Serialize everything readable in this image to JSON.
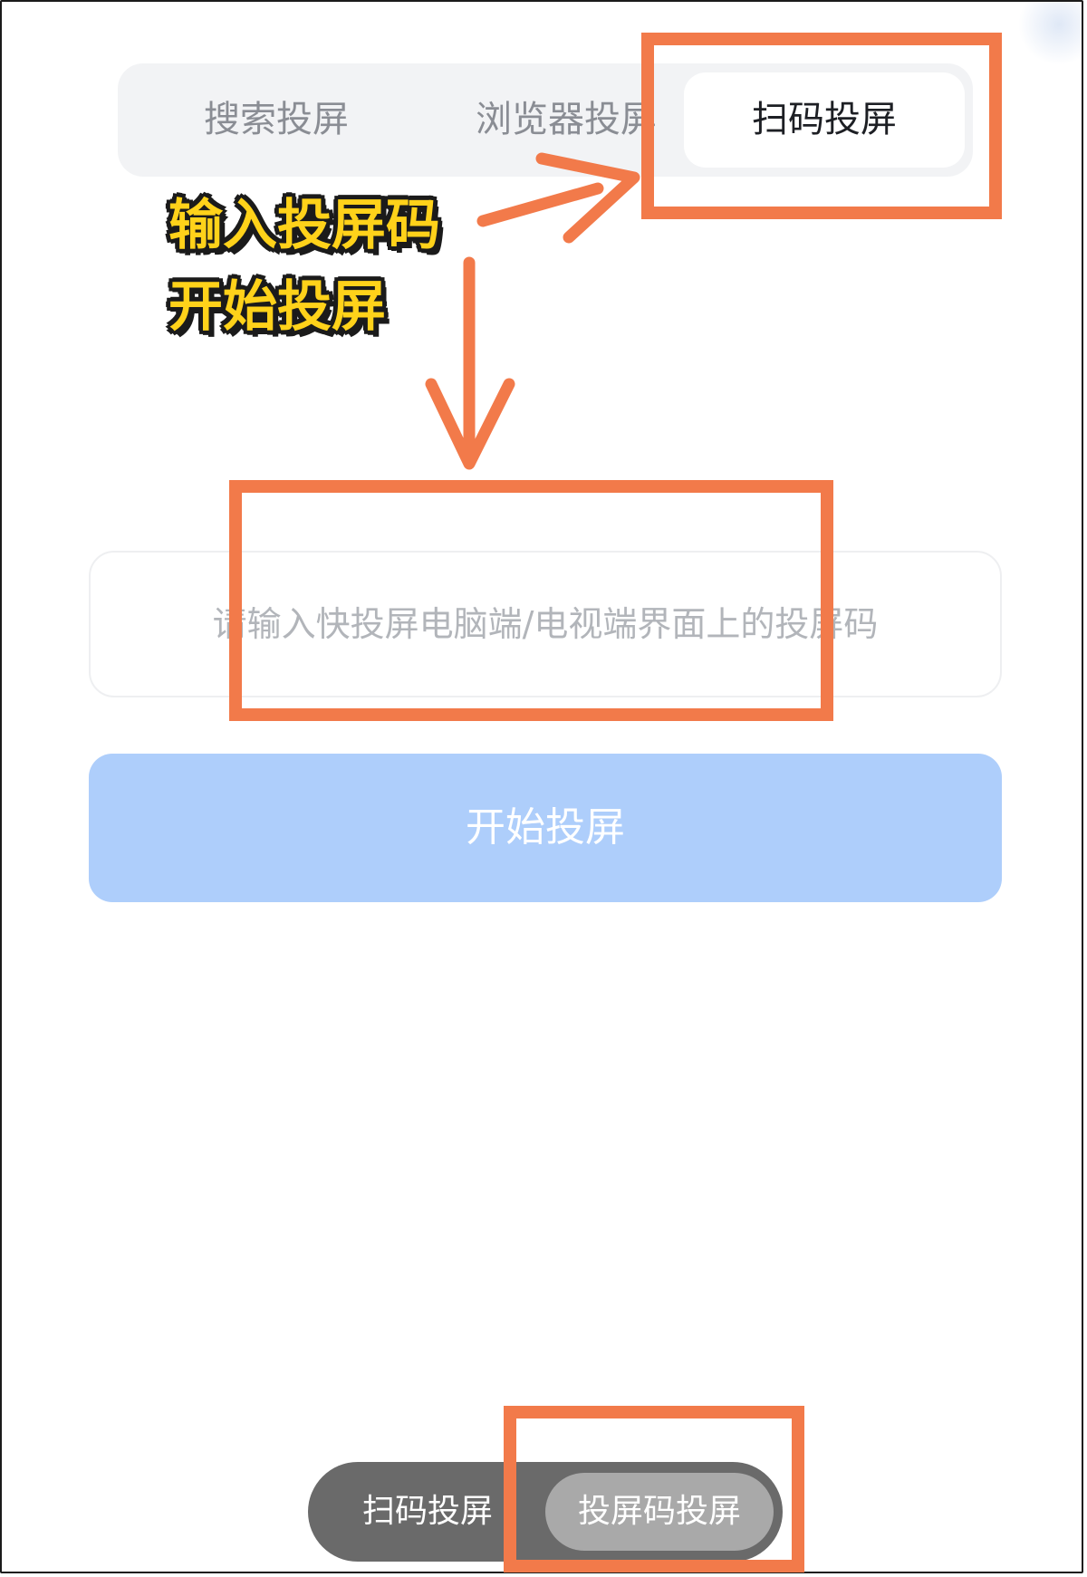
{
  "tabs": {
    "search_label": "搜索投屏",
    "browser_label": "浏览器投屏",
    "scan_label": "扫码投屏",
    "active": "扫码投屏"
  },
  "code_input": {
    "value": "",
    "placeholder": "请输入快投屏电脑端/电视端界面上的投屏码"
  },
  "start_button": {
    "label": "开始投屏"
  },
  "mode_switch": {
    "scan_label": "扫码投屏",
    "code_label": "投屏码投屏",
    "active": "投屏码投屏"
  },
  "annotation": {
    "line1": "输入投屏码",
    "line2": "开始投屏",
    "highlight_color": "#f27a4a",
    "text_color": "#ffd21a"
  },
  "colors": {
    "primary_button": "#aecefb",
    "tab_bar_bg": "#f2f3f5",
    "mode_switch_bg": "#6a6a6a",
    "mode_switch_active_bg": "#a9a9a9"
  }
}
